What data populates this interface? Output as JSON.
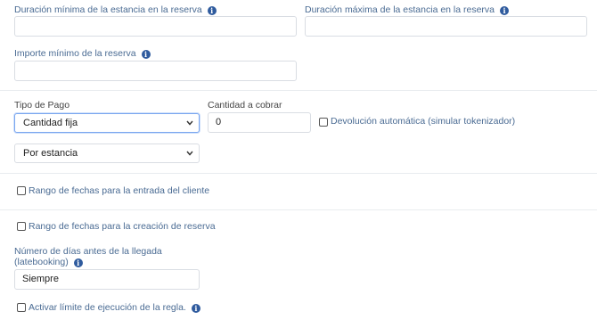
{
  "fields": {
    "min_stay_label": "Duración mínima de la estancia en la reserva",
    "min_stay_value": "",
    "max_stay_label": "Duración máxima de la estancia en la reserva",
    "max_stay_value": "",
    "min_amount_label": "Importe mínimo de la reserva",
    "min_amount_value": "",
    "payment_type_label": "Tipo de Pago",
    "payment_type_value": "Cantidad fija",
    "charge_amount_label": "Cantidad a cobrar",
    "charge_amount_value": "0",
    "auto_refund_label": "Devolución automática (simular tokenizador)",
    "per_unit_value": "Por estancia",
    "arrival_date_range_label": "Rango de fechas para la entrada del cliente",
    "creation_date_range_label": "Rango de fechas para la creación de reserva",
    "days_before_label_line1": "Número de días antes de la llegada",
    "days_before_label_line2": "(latebooking)",
    "days_before_value": "Siempre",
    "execution_limit_label": "Activar límite de ejecución de la regla."
  },
  "icons": {
    "info": "info-icon",
    "chevron": "chevron-down-icon",
    "checkbox": "checkbox-icon"
  },
  "colors": {
    "label": "#4a6b93",
    "info_icon": "#2f5b9e",
    "focus_border": "#7aa6ef"
  }
}
